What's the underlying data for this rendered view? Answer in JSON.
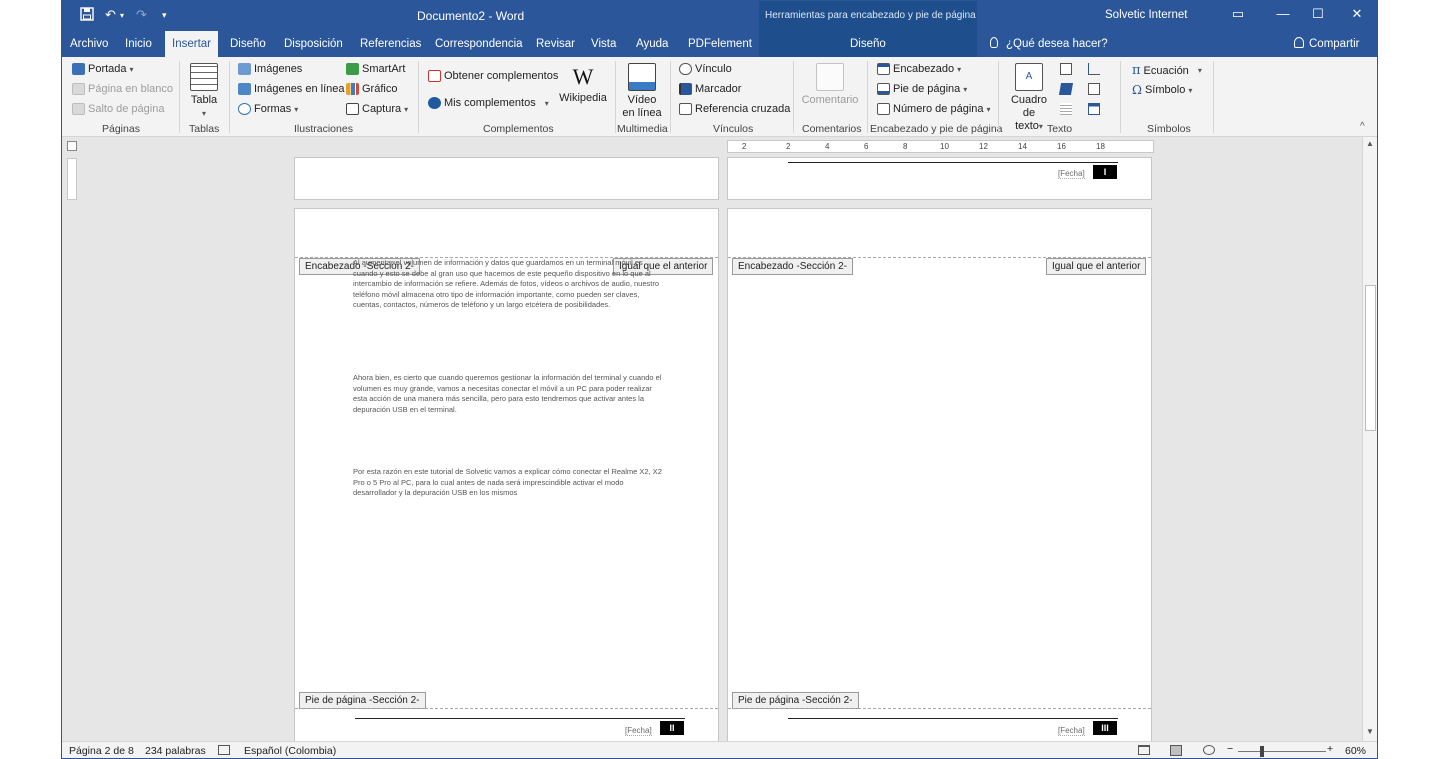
{
  "titlebar": {
    "doc_title": "Documento2 - Word",
    "context_title": "Herramientas para encabezado y pie de página",
    "user": "Solvetic Internet",
    "save_icon": "save-icon",
    "undo_glyph": "↶",
    "redo_glyph": "↷",
    "customize_glyph": "▾",
    "ribbon_display_glyph": "▭",
    "minimize_glyph": "—",
    "maximize_glyph": "☐",
    "close_glyph": "✕"
  },
  "tabs": [
    {
      "label": "Archivo"
    },
    {
      "label": "Inicio"
    },
    {
      "label": "Insertar"
    },
    {
      "label": "Diseño"
    },
    {
      "label": "Disposición"
    },
    {
      "label": "Referencias"
    },
    {
      "label": "Correspondencia"
    },
    {
      "label": "Revisar"
    },
    {
      "label": "Vista"
    },
    {
      "label": "Ayuda"
    },
    {
      "label": "PDFelement"
    },
    {
      "label": "Diseño"
    }
  ],
  "search": {
    "label": "¿Qué desea hacer?"
  },
  "share": {
    "label": "Compartir"
  },
  "ribbon": {
    "paginas": {
      "portada": "Portada",
      "pagina_blanco": "Página en blanco",
      "salto": "Salto de página",
      "label": "Páginas"
    },
    "tablas": {
      "tabla": "Tabla",
      "label": "Tablas"
    },
    "ilustraciones": {
      "imagenes": "Imágenes",
      "imagenes_linea": "Imágenes en línea",
      "formas": "Formas",
      "smartart": "SmartArt",
      "grafico": "Gráfico",
      "captura": "Captura",
      "label": "Ilustraciones"
    },
    "complementos": {
      "obtener": "Obtener complementos",
      "mis": "Mis complementos",
      "wikipedia": "Wikipedia",
      "label": "Complementos"
    },
    "multimedia": {
      "video_1": "Vídeo",
      "video_2": "en línea",
      "label": "Multimedia"
    },
    "vinculos": {
      "vinculo": "Vínculo",
      "marcador": "Marcador",
      "referencia": "Referencia cruzada",
      "label": "Vínculos"
    },
    "comentarios": {
      "comentario": "Comentario",
      "label": "Comentarios"
    },
    "encabezado": {
      "encabezado": "Encabezado",
      "pie": "Pie de página",
      "numero": "Número de página",
      "label": "Encabezado y pie de página"
    },
    "texto": {
      "cuadro_1": "Cuadro de",
      "cuadro_2": "texto",
      "label": "Texto"
    },
    "simbolos": {
      "ecuacion": "Ecuación",
      "simbolo": "Símbolo",
      "label": "Símbolos"
    }
  },
  "ruler": {
    "ticks": [
      "2",
      "2",
      "4",
      "6",
      "8",
      "10",
      "12",
      "14",
      "16",
      "18"
    ]
  },
  "pages": {
    "fecha": "[Fecha]",
    "top_right_num": "I",
    "left": {
      "header_tag": "Encabezado -Sección 2-",
      "same_tag": "Igual que el anterior",
      "footer_tag": "Pie de página -Sección 2-",
      "footer_num": "II",
      "paragraphs": [
        "Al aumentar el volumen de información y datos que guardamos en un terminal móvil es cuando y esto se debe al gran uso que hacemos de este pequeño dispositivo en lo que al intercambio de información se refiere. Además de fotos, vídeos o archivos de audio, nuestro teléfono móvil almacena otro tipo de información importante, como pueden ser claves, cuentas, contactos, números de teléfono y un largo etcétera de posibilidades.",
        "Ahora bien, es cierto que cuando queremos gestionar la información del terminal y cuando el volumen es muy grande, vamos a necesitas conectar el móvil a un PC para poder realizar esta acción de una manera más sencilla, pero para esto tendremos que activar antes la depuración USB en el terminal.",
        "Por esta razón en este tutorial de Solvetic vamos a explicar cómo conectar el Realme X2, X2 Pro o 5 Pro al PC, para lo cual antes de nada será imprescindible activar el modo desarrollador y la depuración USB en los mismos"
      ]
    },
    "right": {
      "header_tag": "Encabezado -Sección 2-",
      "same_tag": "Igual que el anterior",
      "footer_tag": "Pie de página -Sección 2-",
      "footer_num": "III"
    }
  },
  "statusbar": {
    "page": "Página 2 de 8",
    "words": "234 palabras",
    "language": "Español (Colombia)",
    "zoom": "60%",
    "zoom_level_percent": 60
  }
}
